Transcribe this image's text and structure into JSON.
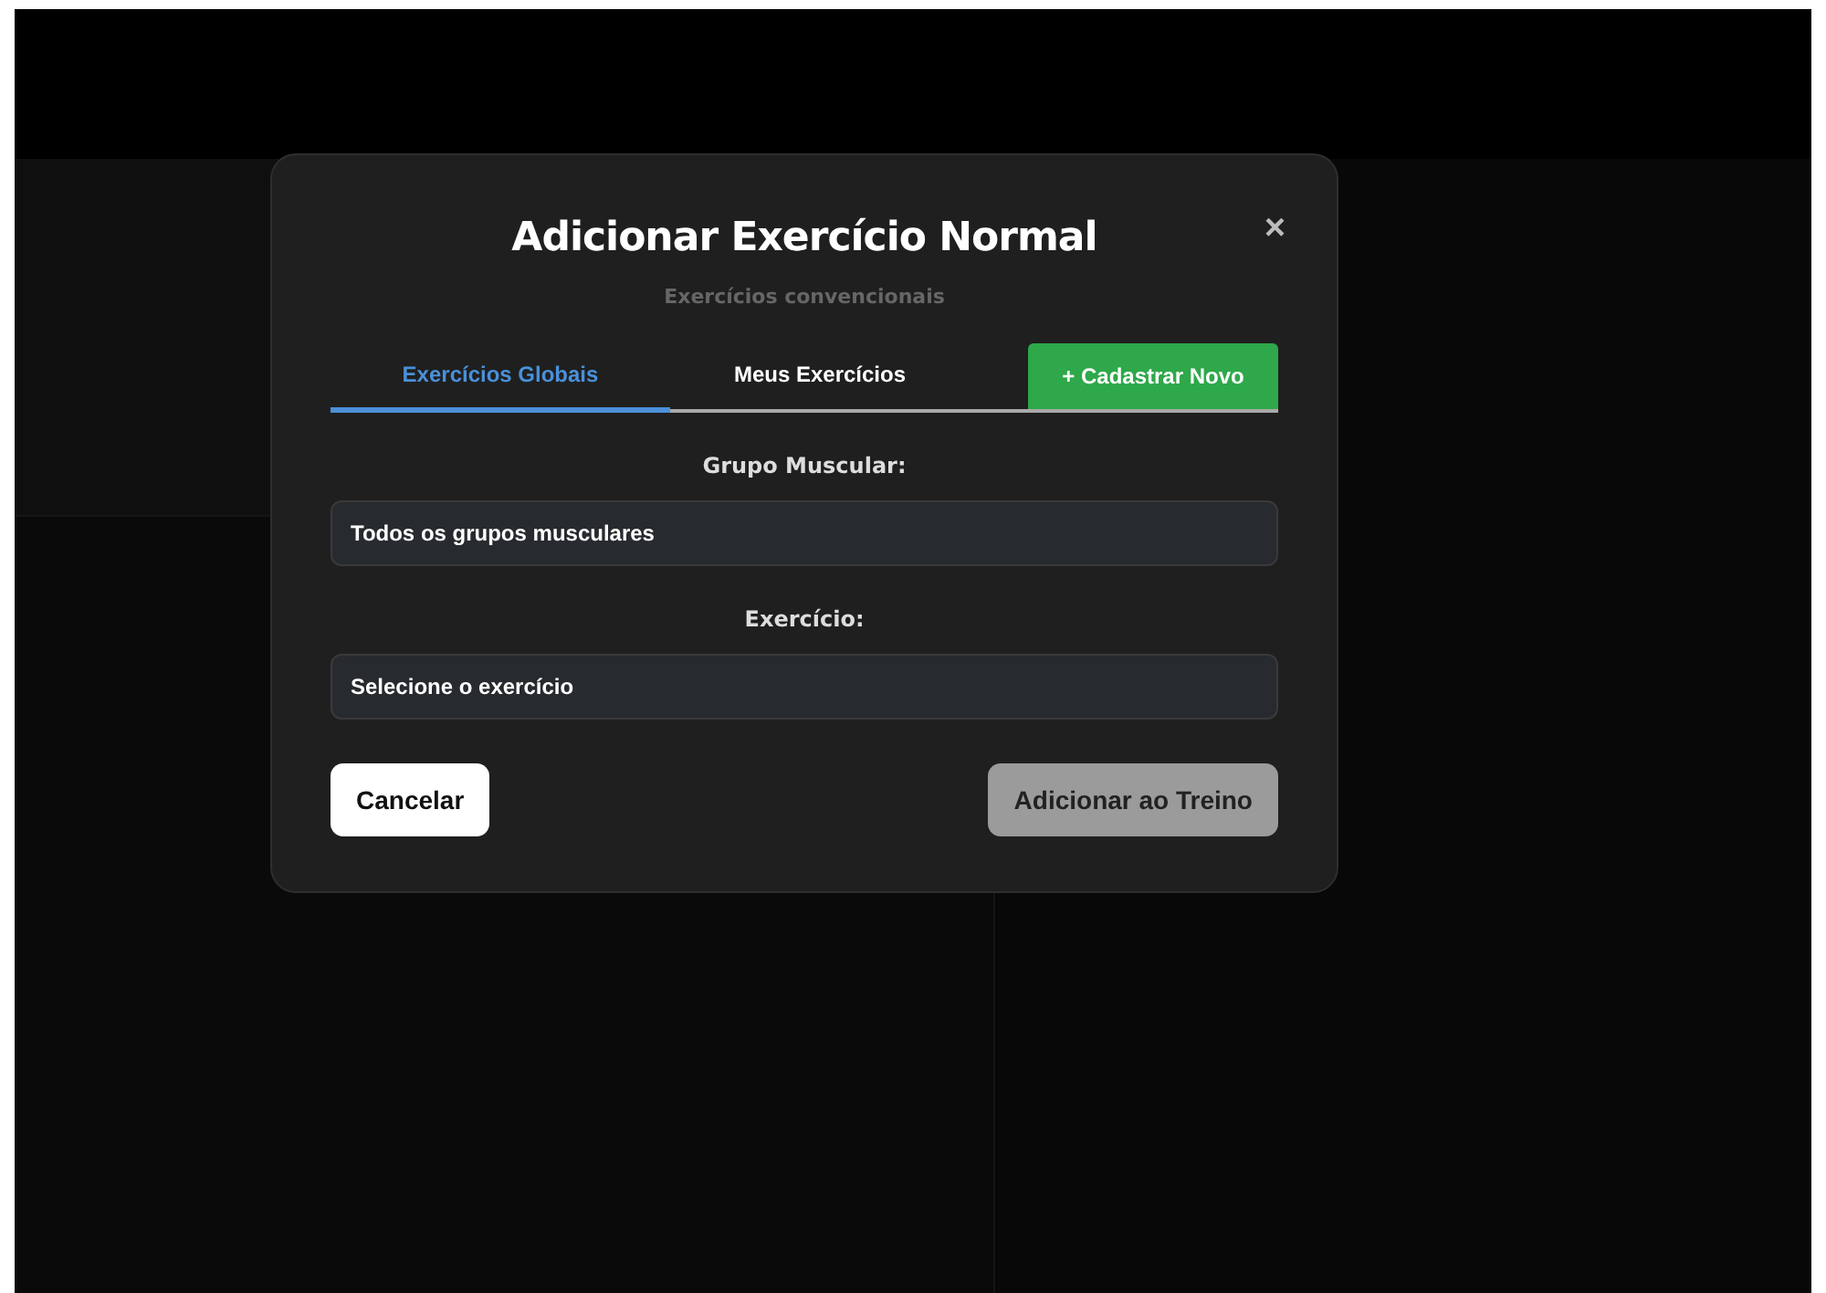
{
  "dialog": {
    "title": "Adicionar Exercício Normal",
    "subtitle": "Exercícios convencionais",
    "close": "×",
    "tabs": [
      {
        "label": "Exercícios Globais",
        "selected": true
      },
      {
        "label": "Meus Exercícios",
        "selected": false
      }
    ],
    "register_button": "+ Cadastrar Novo",
    "fields": [
      {
        "label": "Grupo Muscular:",
        "value": "Todos os grupos musculares"
      },
      {
        "label": "Exercício:",
        "value": "Selecione o exercício"
      }
    ],
    "buttons": [
      {
        "label": "Cancelar",
        "kind": "secondary",
        "disabled": false
      },
      {
        "label": "Adicionar ao Treino",
        "kind": "primary",
        "disabled": true
      }
    ]
  }
}
